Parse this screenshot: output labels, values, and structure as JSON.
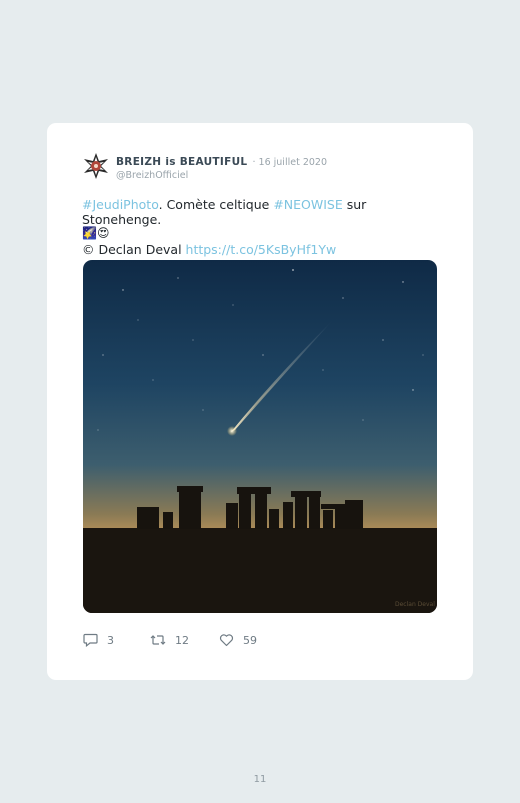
{
  "tweet": {
    "display_name": "BREIZH is BEAUTIFUL",
    "date": "· 16 juillet 2020",
    "handle": "@BreizhOfficiel",
    "text": {
      "hashtag1": "#JeudiPhoto",
      "part1": ". Comète celtique ",
      "hashtag2": "#NEOWISE",
      "part2": " sur Stonehenge.",
      "emojis": "🌠😍",
      "copyright": "©",
      "credit": " Declan Deval ",
      "link": "https://t.co/5KsByHf1Yw"
    },
    "photo_watermark": "Declan Deval",
    "replies": "3",
    "retweets": "12",
    "likes": "59"
  },
  "page_number": "11",
  "colors": {
    "background": "#e6ecee",
    "card": "#ffffff",
    "link": "#7cc3e0",
    "muted": "#9aa4ab"
  }
}
